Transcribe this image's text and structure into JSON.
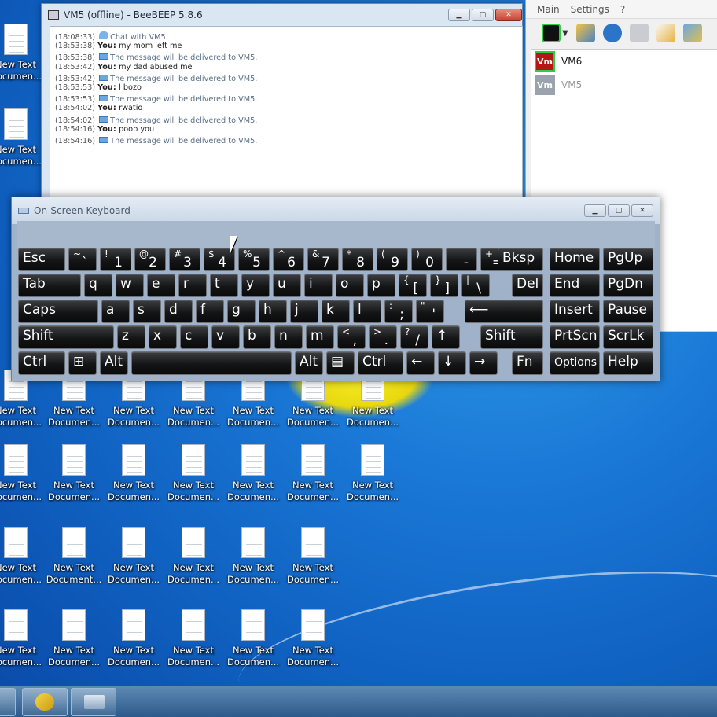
{
  "desktop": {
    "icon_label_line1": "New Text",
    "icon_label_line2": "Documen...",
    "icon_label_line2_alt": "Document..."
  },
  "chat_window": {
    "title": "VM5 (offline) - BeeBEEP 5.8.6",
    "side_avatar": "Vm",
    "messages": [
      {
        "time": "(18:08:33)",
        "type": "system",
        "text": "Chat with VM5."
      },
      {
        "time": "(18:53:38)",
        "sender": "You:",
        "text": "my mom left me"
      },
      {
        "time": "(18:53:38)",
        "type": "system",
        "text": "The message will be delivered to VM5."
      },
      {
        "time": "(18:53:42)",
        "sender": "You:",
        "text": "my dad abused me"
      },
      {
        "time": "(18:53:42)",
        "type": "system",
        "text": "The message will be delivered to VM5."
      },
      {
        "time": "(18:53:53)",
        "sender": "You:",
        "text": "l bozo"
      },
      {
        "time": "(18:53:53)",
        "type": "system",
        "text": "The message will be delivered to VM5."
      },
      {
        "time": "(18:54:02)",
        "sender": "You:",
        "text": "rwatio"
      },
      {
        "time": "(18:54:02)",
        "type": "system",
        "text": "The message will be delivered to VM5."
      },
      {
        "time": "(18:54:16)",
        "sender": "You:",
        "text": "poop you"
      },
      {
        "time": "(18:54:16)",
        "type": "system",
        "text": "The message will be delivered to VM5."
      }
    ]
  },
  "beebeep_main": {
    "menu": [
      "Main",
      "Settings",
      "?"
    ],
    "users": [
      {
        "avatar": "Vm",
        "name": "VM6",
        "status": "online"
      },
      {
        "avatar": "Vm",
        "name": "VM5",
        "status": "offline"
      }
    ]
  },
  "osk": {
    "title": "On-Screen Keyboard",
    "rows": [
      [
        {
          "p": "Esc"
        },
        {
          "s": "~",
          "m": "`"
        },
        {
          "s": "!",
          "m": "1"
        },
        {
          "s": "@",
          "m": "2"
        },
        {
          "s": "#",
          "m": "3"
        },
        {
          "s": "$",
          "m": "4"
        },
        {
          "s": "%",
          "m": "5"
        },
        {
          "s": "^",
          "m": "6"
        },
        {
          "s": "&",
          "m": "7"
        },
        {
          "s": "*",
          "m": "8"
        },
        {
          "s": "(",
          "m": "9"
        },
        {
          "s": ")",
          "m": "0"
        },
        {
          "s": "_",
          "m": "-"
        },
        {
          "s": "+",
          "m": "="
        },
        {
          "p": "Bksp"
        },
        {
          "p": "Home"
        },
        {
          "p": "PgUp"
        }
      ],
      [
        {
          "p": "Tab"
        },
        {
          "p": "q"
        },
        {
          "p": "w"
        },
        {
          "p": "e"
        },
        {
          "p": "r"
        },
        {
          "p": "t"
        },
        {
          "p": "y"
        },
        {
          "p": "u"
        },
        {
          "p": "i"
        },
        {
          "p": "o"
        },
        {
          "p": "p"
        },
        {
          "s": "{",
          "m": "["
        },
        {
          "s": "}",
          "m": "]"
        },
        {
          "s": "|",
          "m": "\\"
        },
        {
          "p": "Del"
        },
        {
          "p": "End"
        },
        {
          "p": "PgDn"
        }
      ],
      [
        {
          "p": "Caps"
        },
        {
          "p": "a"
        },
        {
          "p": "s"
        },
        {
          "p": "d"
        },
        {
          "p": "f"
        },
        {
          "p": "g"
        },
        {
          "p": "h"
        },
        {
          "p": "j"
        },
        {
          "p": "k"
        },
        {
          "p": "l"
        },
        {
          "s": ":",
          "m": ";"
        },
        {
          "s": "\"",
          "m": "'"
        },
        {
          "p": "⟵"
        },
        {
          "p": "Insert"
        },
        {
          "p": "Pause"
        }
      ],
      [
        {
          "p": "Shift"
        },
        {
          "p": "z"
        },
        {
          "p": "x"
        },
        {
          "p": "c"
        },
        {
          "p": "v"
        },
        {
          "p": "b"
        },
        {
          "p": "n"
        },
        {
          "p": "m"
        },
        {
          "s": "<",
          "m": ","
        },
        {
          "s": ">",
          "m": "."
        },
        {
          "s": "?",
          "m": "/"
        },
        {
          "p": "↑"
        },
        {
          "p": "Shift"
        },
        {
          "p": "PrtScn"
        },
        {
          "p": "ScrLk"
        }
      ],
      [
        {
          "p": "Ctrl"
        },
        {
          "p": "⊞"
        },
        {
          "p": "Alt"
        },
        {
          "p": ""
        },
        {
          "p": "Alt"
        },
        {
          "p": "▤"
        },
        {
          "p": "Ctrl"
        },
        {
          "p": "←"
        },
        {
          "p": "↓"
        },
        {
          "p": "→"
        },
        {
          "p": "Fn"
        },
        {
          "p": "Options"
        },
        {
          "p": "Help"
        }
      ]
    ]
  },
  "taskbar": {
    "buttons": [
      "start-orb",
      "beebeep",
      "on-screen-keyboard"
    ]
  }
}
